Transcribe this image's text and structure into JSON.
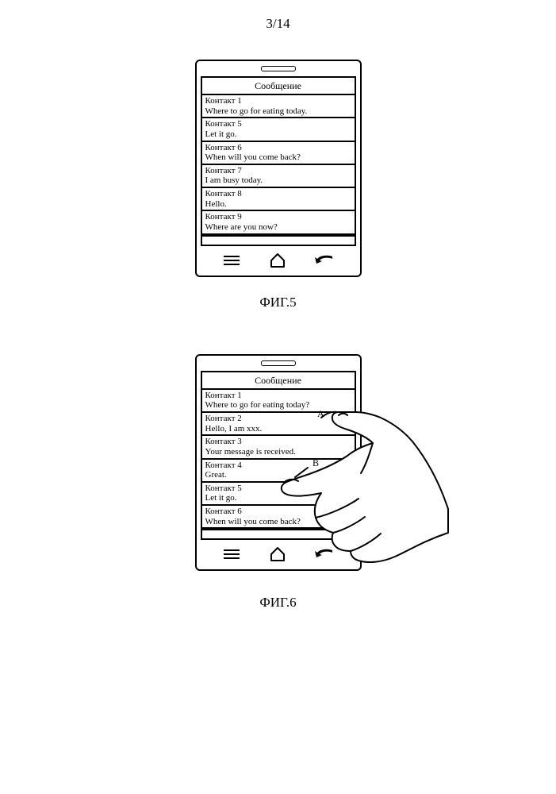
{
  "page_number": "3/14",
  "fig5": {
    "title": "Сообщение",
    "items": [
      {
        "name": "Контакт 1",
        "preview": "Where to go for eating today."
      },
      {
        "name": "Контакт 5",
        "preview": "Let it go."
      },
      {
        "name": "Контакт 6",
        "preview": "When will you come back?"
      },
      {
        "name": "Контакт 7",
        "preview": "I am busy today."
      },
      {
        "name": "Контакт 8",
        "preview": "Hello."
      },
      {
        "name": "Контакт 9",
        "preview": "Where are you now?"
      }
    ],
    "caption": "ФИГ.5"
  },
  "fig6": {
    "title": "Сообщение",
    "items": [
      {
        "name": "Контакт 1",
        "preview": "Where to go for eating today?"
      },
      {
        "name": "Контакт 2",
        "preview": "Hello, I am xxx."
      },
      {
        "name": "Контакт 3",
        "preview": "Your message is received."
      },
      {
        "name": "Контакт 4",
        "preview": "Great."
      },
      {
        "name": "Контакт 5",
        "preview": "Let it go."
      },
      {
        "name": "Контакт 6",
        "preview": "When will you come back?"
      }
    ],
    "touch_points": {
      "A": "A",
      "B": "B"
    },
    "caption": "ФИГ.6"
  }
}
